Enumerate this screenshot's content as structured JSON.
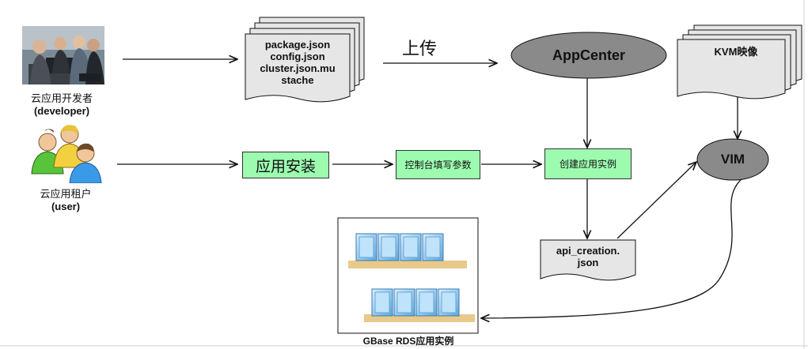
{
  "developer": {
    "label_cn": "云应用开发者",
    "label_en": "(developer)"
  },
  "user": {
    "label_cn": "云应用租户",
    "label_en": "(user)"
  },
  "package_docs": {
    "lines": [
      "package.json",
      "config.json",
      "cluster.json.mu",
      "stache"
    ]
  },
  "upload_label": "上传",
  "appcenter": {
    "label": "AppCenter"
  },
  "kvm": {
    "label": "KVM映像"
  },
  "vim": {
    "label": "VIM"
  },
  "install_box": {
    "label": "应用安装"
  },
  "console_box": {
    "label": "控制台填写参数"
  },
  "create_box": {
    "label": "创建应用实例"
  },
  "api_doc": {
    "lines": [
      "api_creation.",
      "json"
    ]
  },
  "gbase": {
    "label": "GBase RDS应用实例"
  },
  "colors": {
    "green_box": "#9dfbb0",
    "ellipse": "#8a8a8a",
    "doc": "#e6e6e6"
  }
}
